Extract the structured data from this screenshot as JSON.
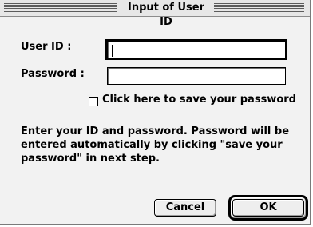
{
  "window": {
    "title": "Input of User ID"
  },
  "form": {
    "user_id_label": "User ID :",
    "user_id_value": "",
    "password_label": "Password :",
    "password_value": ""
  },
  "save_password": {
    "label": "Click here to save your password",
    "checked": false
  },
  "message": "Enter your ID and password. Password will be entered automatically by clicking \"save your password\" in next step.",
  "buttons": {
    "cancel": "Cancel",
    "ok": "OK"
  }
}
